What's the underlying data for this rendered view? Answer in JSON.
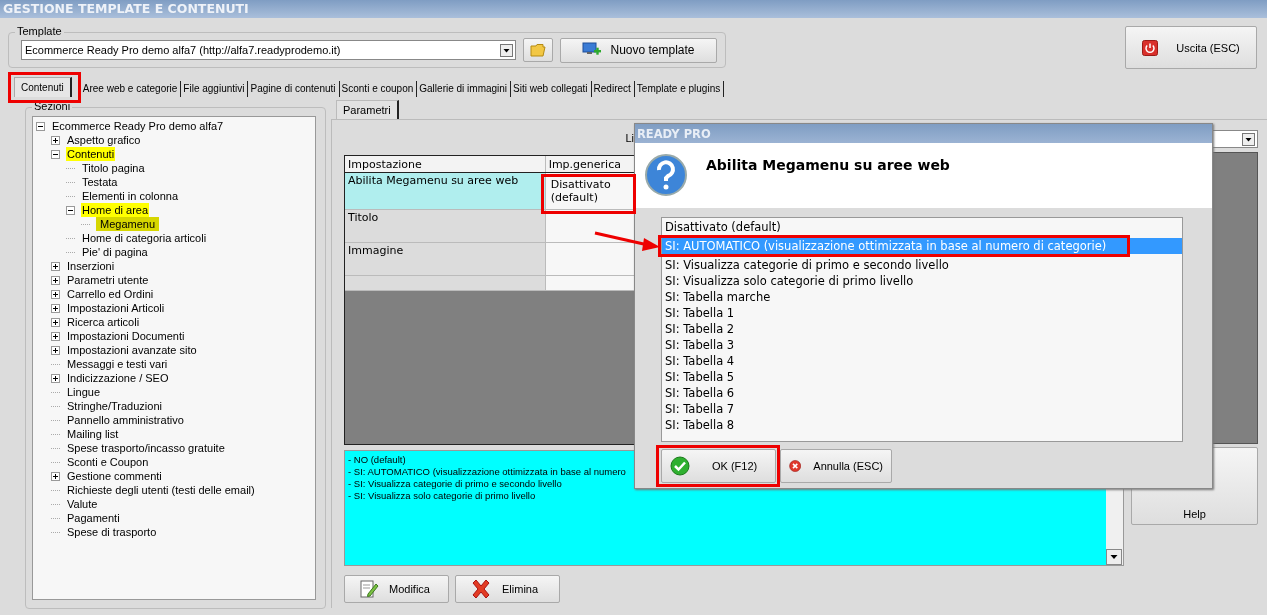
{
  "window": {
    "title": "GESTIONE TEMPLATE E CONTENUTI"
  },
  "template": {
    "label": "Template",
    "value": "Ecommerce Ready Pro demo alfa7 (http://alfa7.readyprodemo.it)",
    "new_button": "Nuovo template"
  },
  "exit_button": "Uscita (ESC)",
  "tabs": [
    {
      "label": "Contenuti",
      "selected": true
    },
    {
      "label": "Aree web e categorie",
      "selected": false
    },
    {
      "label": "File aggiuntivi",
      "selected": false
    },
    {
      "label": "Pagine di contenuti",
      "selected": false
    },
    {
      "label": "Sconti e coupon",
      "selected": false
    },
    {
      "label": "Gallerie di immagini",
      "selected": false
    },
    {
      "label": "Siti web collegati",
      "selected": false
    },
    {
      "label": "Redirect",
      "selected": false
    },
    {
      "label": "Template e plugins",
      "selected": false
    }
  ],
  "sections": {
    "label": "Sezioni",
    "tree": [
      {
        "label": "Ecommerce Ready Pro demo alfa7",
        "expanded": true,
        "selected": false,
        "highlighted": false,
        "children": [
          {
            "label": "Aspetto grafico",
            "expanded": false,
            "selected": false,
            "highlighted": false
          },
          {
            "label": "Contenuti",
            "expanded": true,
            "selected": false,
            "highlighted": true,
            "children": [
              {
                "label": "Titolo pagina",
                "selected": false,
                "highlighted": false
              },
              {
                "label": "Testata",
                "selected": false,
                "highlighted": false
              },
              {
                "label": "Elementi in colonna",
                "selected": false,
                "highlighted": false
              },
              {
                "label": "Home di area",
                "expanded": true,
                "selected": false,
                "highlighted": true,
                "children": [
                  {
                    "label": "Megamenu",
                    "selected": true,
                    "highlighted": true
                  }
                ]
              },
              {
                "label": "Home di categoria articoli",
                "selected": false,
                "highlighted": false
              },
              {
                "label": "Pie' di pagina",
                "selected": false,
                "highlighted": false
              }
            ]
          },
          {
            "label": "Inserzioni",
            "expanded": false,
            "selected": false,
            "highlighted": false
          },
          {
            "label": "Parametri utente",
            "expanded": false,
            "selected": false,
            "highlighted": false
          },
          {
            "label": "Carrello ed Ordini",
            "expanded": false,
            "selected": false,
            "highlighted": false
          },
          {
            "label": "Impostazioni Articoli",
            "expanded": false,
            "selected": false,
            "highlighted": false
          },
          {
            "label": "Ricerca articoli",
            "expanded": false,
            "selected": false,
            "highlighted": false
          },
          {
            "label": "Impostazioni Documenti",
            "expanded": false,
            "selected": false,
            "highlighted": false
          },
          {
            "label": "Impostazioni avanzate sito",
            "expanded": false,
            "selected": false,
            "highlighted": false
          },
          {
            "label": "Messaggi e testi vari",
            "selected": false,
            "highlighted": false
          },
          {
            "label": "Indicizzazione / SEO",
            "expanded": false,
            "selected": false,
            "highlighted": false
          },
          {
            "label": "Lingue",
            "selected": false,
            "highlighted": false
          },
          {
            "label": "Stringhe/Traduzioni",
            "selected": false,
            "highlighted": false
          },
          {
            "label": "Pannello amministrativo",
            "selected": false,
            "highlighted": false
          },
          {
            "label": "Mailing list",
            "selected": false,
            "highlighted": false
          },
          {
            "label": "Spese trasporto/incasso gratuite",
            "selected": false,
            "highlighted": false
          },
          {
            "label": "Sconti e Coupon",
            "selected": false,
            "highlighted": false
          },
          {
            "label": "Gestione commenti",
            "expanded": false,
            "selected": false,
            "highlighted": false
          },
          {
            "label": "Richieste degli utenti (testi delle email)",
            "selected": false,
            "highlighted": false
          },
          {
            "label": "Valute",
            "selected": false,
            "highlighted": false
          },
          {
            "label": "Pagamenti",
            "selected": false,
            "highlighted": false
          },
          {
            "label": "Spese di trasporto",
            "selected": false,
            "highlighted": false
          }
        ]
      }
    ]
  },
  "sub_tabs": [
    {
      "label": "Parametri",
      "selected": true
    }
  ],
  "partial_label": "Li",
  "table": {
    "columns": [
      "Impostazione",
      "Imp.generica"
    ],
    "rows": [
      {
        "cells": [
          "Abilita Megamenu su aree web",
          "Disattivato (default)"
        ],
        "selected": true
      },
      {
        "cells": [
          "Titolo"
        ],
        "selected": false
      },
      {
        "cells": [
          "Immagine"
        ],
        "selected": false
      }
    ]
  },
  "description": [
    "- NO (default)",
    "- SI: AUTOMATICO (visualizzazione ottimizzata in base al numero",
    "- SI: Visualizza categorie di primo e secondo livello",
    "- SI: Visualizza solo categorie di primo livello"
  ],
  "help_button": "Help",
  "buttons": [
    {
      "kind": "edit",
      "label": "Modifica"
    },
    {
      "kind": "delete",
      "label": "Elimina"
    }
  ],
  "dialog": {
    "title": "READY PRO",
    "question": "Abilita Megamenu su aree web",
    "options": [
      {
        "label": "Disattivato (default)",
        "selected": false
      },
      {
        "label": "SI: AUTOMATICO (visualizzazione ottimizzata in base al numero di categorie)",
        "selected": true
      },
      {
        "label": "SI: Visualizza categorie di primo e secondo livello",
        "selected": false
      },
      {
        "label": "SI: Visualizza solo categorie di primo livello",
        "selected": false
      },
      {
        "label": "SI: Tabella marche",
        "selected": false
      },
      {
        "label": "SI: Tabella 1",
        "selected": false
      },
      {
        "label": "SI: Tabella 2",
        "selected": false
      },
      {
        "label": "SI: Tabella 3",
        "selected": false
      },
      {
        "label": "SI: Tabella 4",
        "selected": false
      },
      {
        "label": "SI: Tabella 5",
        "selected": false
      },
      {
        "label": "SI: Tabella 6",
        "selected": false
      },
      {
        "label": "SI: Tabella 7",
        "selected": false
      },
      {
        "label": "SI: Tabella 8",
        "selected": false
      }
    ],
    "ok": "OK (F12)",
    "cancel": "Annulla (ESC)"
  }
}
